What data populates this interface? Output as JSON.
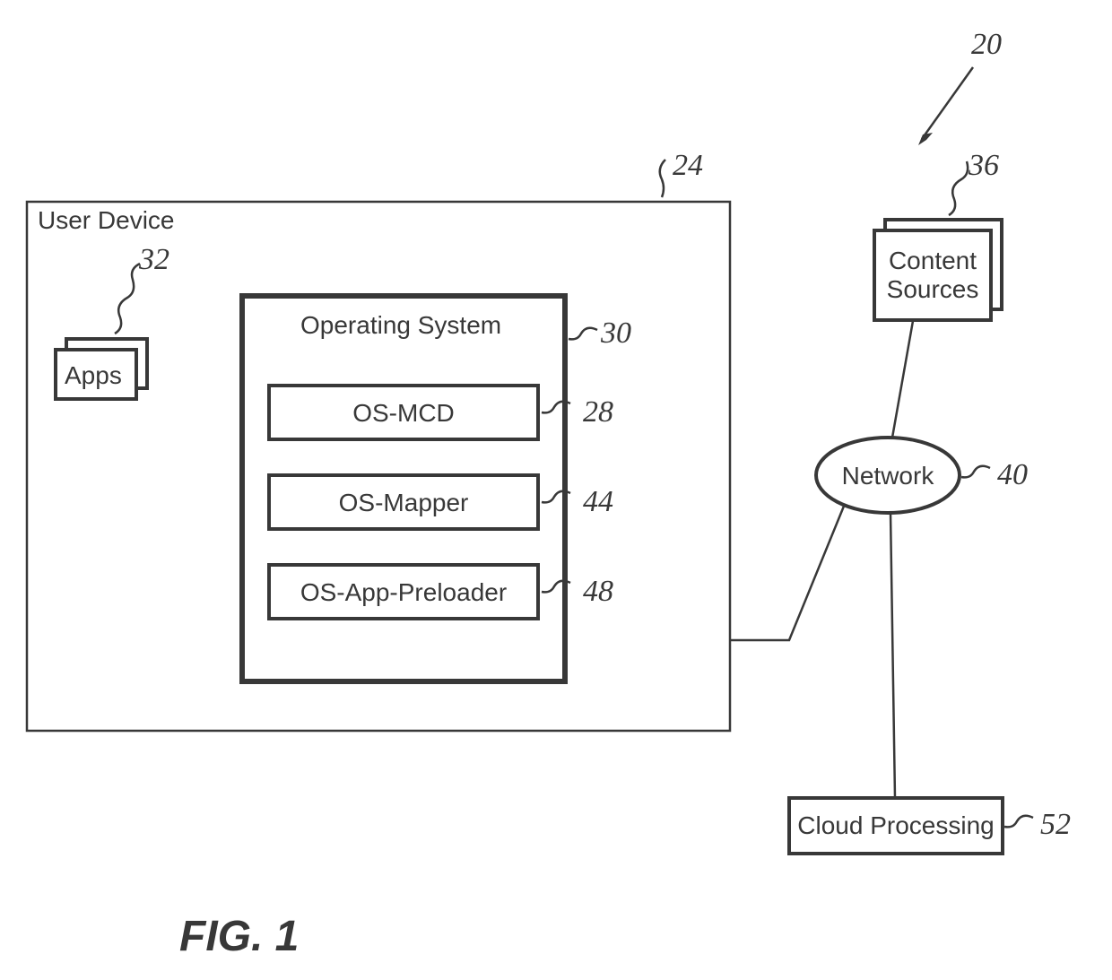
{
  "figure": {
    "caption": "FIG. 1"
  },
  "refs": {
    "system": "20",
    "user_device": "24",
    "os_mcd": "28",
    "operating_system": "30",
    "apps": "32",
    "content_sources": "36",
    "network": "40",
    "os_mapper": "44",
    "os_preloader": "48",
    "cloud_processing": "52"
  },
  "labels": {
    "user_device": "User Device",
    "apps": "Apps",
    "operating_system": "Operating System",
    "os_mcd": "OS-MCD",
    "os_mapper": "OS-Mapper",
    "os_preloader": "OS-App-Preloader",
    "content_sources_l1": "Content",
    "content_sources_l2": "Sources",
    "network": "Network",
    "cloud_processing": "Cloud Processing"
  }
}
